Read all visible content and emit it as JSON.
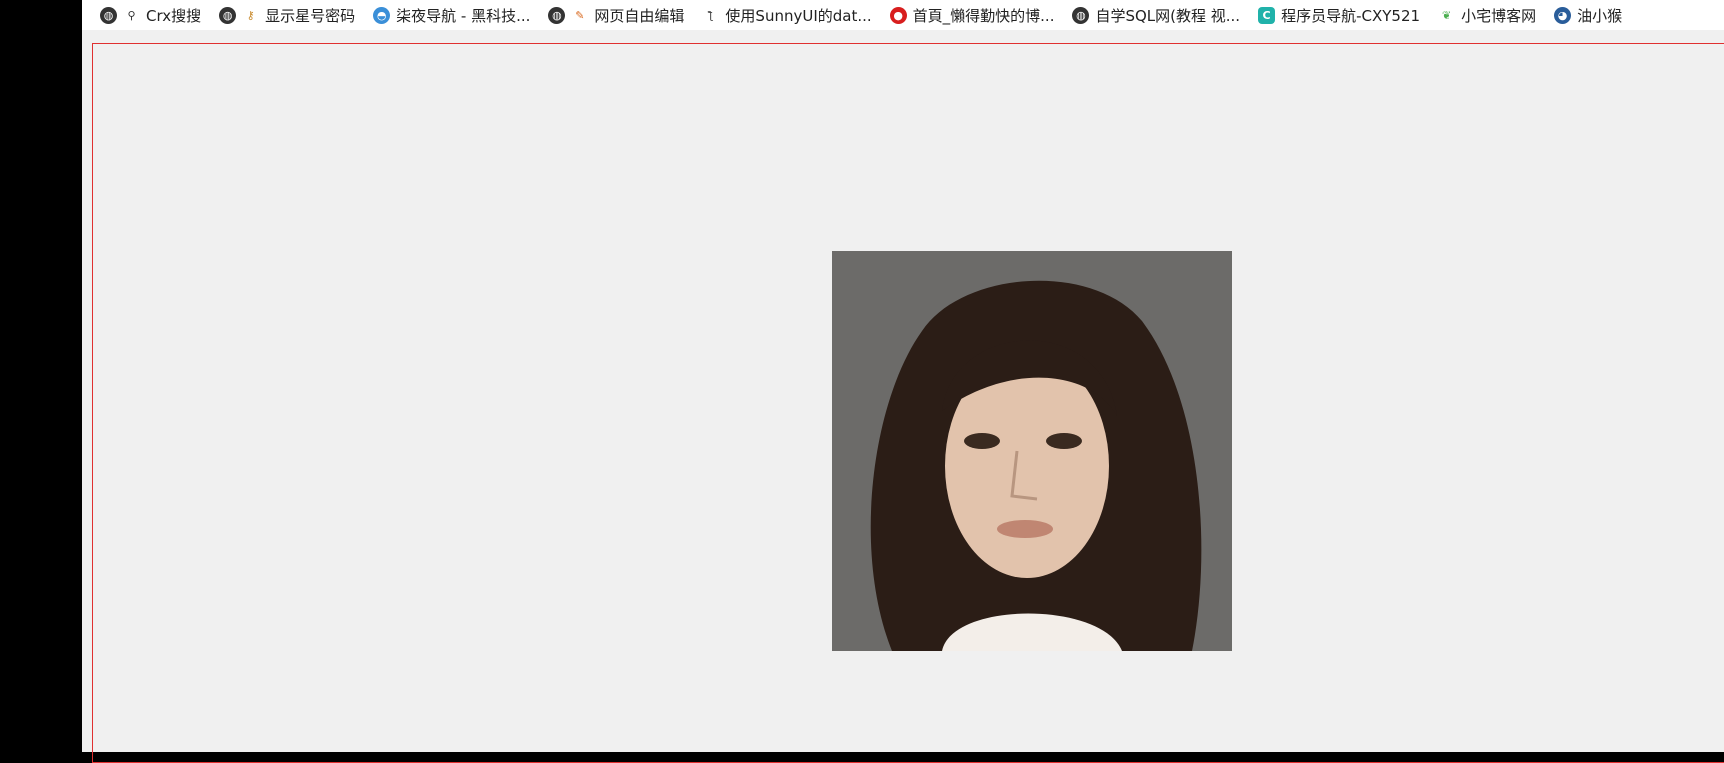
{
  "bookmarks": [
    {
      "label": "Crx搜搜",
      "icons": [
        "globe-icon",
        "magnifier-icon"
      ]
    },
    {
      "label": "显示星号密码",
      "icons": [
        "globe-icon",
        "key-icon"
      ]
    },
    {
      "label": "柒夜导航 - 黑科技...",
      "icons": [
        "blue-bird-icon"
      ]
    },
    {
      "label": "网页自由编辑",
      "icons": [
        "globe-icon",
        "pencil-icon"
      ]
    },
    {
      "label": "使用SunnyUI的dat...",
      "icons": [
        "sketch-icon"
      ]
    },
    {
      "label": "首頁_懶得勤快的博...",
      "icons": [
        "red-fruit-icon"
      ]
    },
    {
      "label": "自学SQL网(教程 视...",
      "icons": [
        "globe-icon"
      ]
    },
    {
      "label": "程序员导航-CXY521",
      "icons": [
        "c-logo-icon"
      ]
    },
    {
      "label": "小宅博客网",
      "icons": [
        "green-leaf-icon"
      ]
    },
    {
      "label": "油小猴",
      "icons": [
        "monkey-icon"
      ]
    }
  ],
  "colors": {
    "frame_border": "#e03030",
    "page_bg": "#f0f0f0",
    "photo_bg": "#6c6b69"
  }
}
